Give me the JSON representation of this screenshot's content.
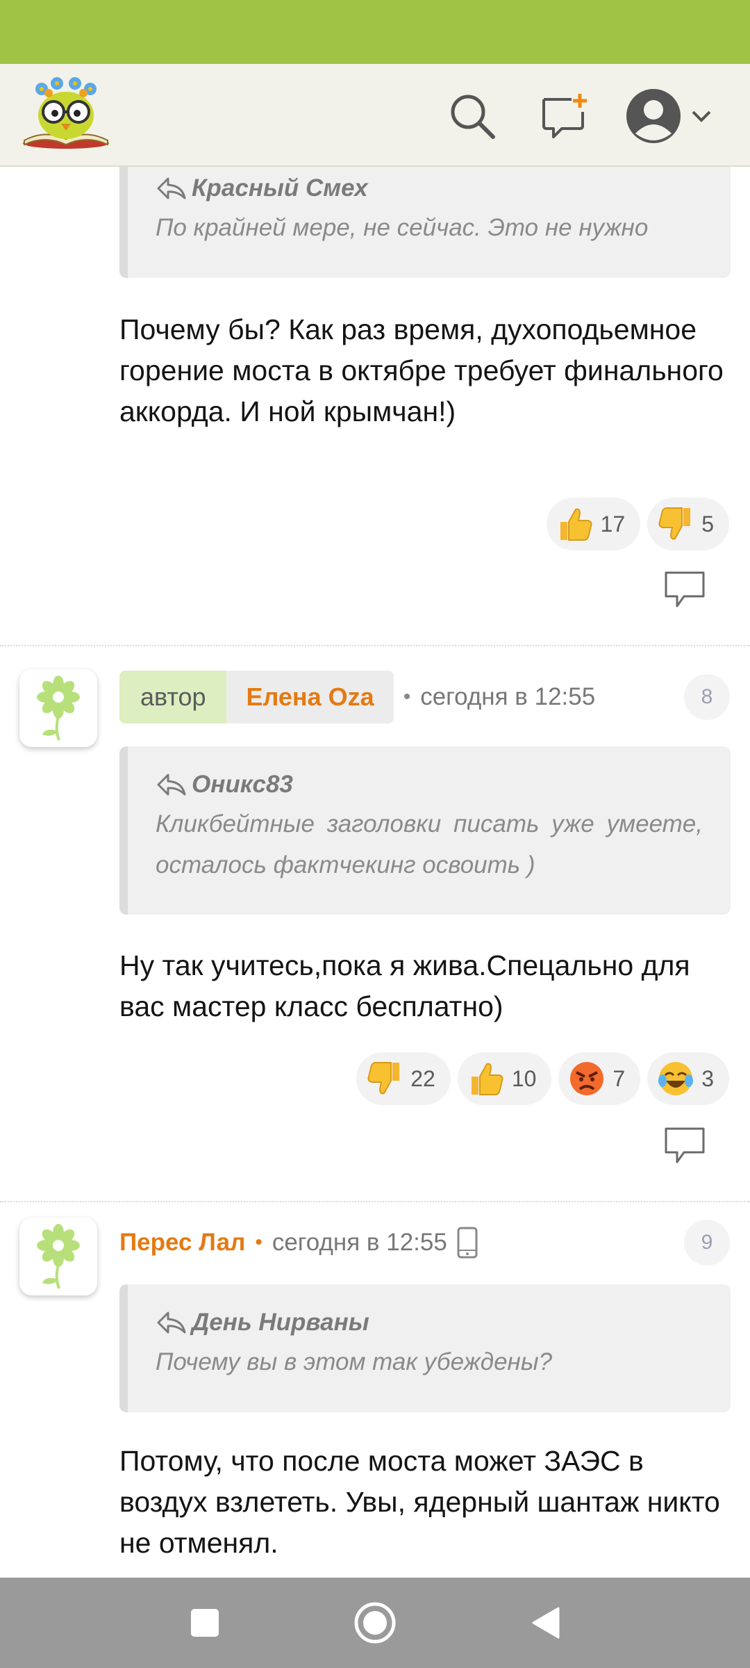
{
  "header": {
    "logo_icon": "owl-book-logo",
    "search_icon": "search-icon",
    "new_message_icon": "new-message-icon",
    "profile_icon": "user-avatar-icon",
    "dropdown_icon": "chevron-down-icon"
  },
  "comments": [
    {
      "quote": {
        "author": "Красный Смех",
        "text": "По крайней мере, не сейчас. Это не нужно"
      },
      "body": "Почему бы? Как раз время, духоподьемное горение моста в октябре требует финального аккорда. И ной крымчан!)",
      "reactions": [
        {
          "emoji": "thumbs-up",
          "count": "17"
        },
        {
          "emoji": "thumbs-down",
          "count": "5"
        }
      ]
    },
    {
      "role_badge": "автор",
      "author": "Елена Oza",
      "time": "сегодня в 12:55",
      "number": "8",
      "quote": {
        "author": "Оникс83",
        "text": "Кликбейтные заголовки писать уже умеете, осталось фактчекинг освоить )"
      },
      "body": "Ну так учитесь,пока я жива.Спецально для вас мастер класс бесплатно)",
      "reactions": [
        {
          "emoji": "thumbs-down",
          "count": "22"
        },
        {
          "emoji": "thumbs-up",
          "count": "10"
        },
        {
          "emoji": "angry-face",
          "count": "7"
        },
        {
          "emoji": "tears-of-joy",
          "count": "3"
        }
      ]
    },
    {
      "author": "Перес Лал",
      "time": "сегодня в 12:55",
      "device_icon": "mobile-phone-icon",
      "number": "9",
      "quote": {
        "author": "День Нирваны",
        "text": "Почему вы в этом так убеждены?"
      },
      "body": "Потому, что после моста может ЗАЭС в воздух взлететь. Увы, ядерный шантаж никто не отменял."
    }
  ],
  "navbar": {
    "recents_icon": "square-icon",
    "home_icon": "circle-icon",
    "back_icon": "triangle-back-icon"
  },
  "colors": {
    "status_bar": "#9fc342",
    "accent_orange": "#e47a12",
    "author_badge": "#ddeec0"
  }
}
